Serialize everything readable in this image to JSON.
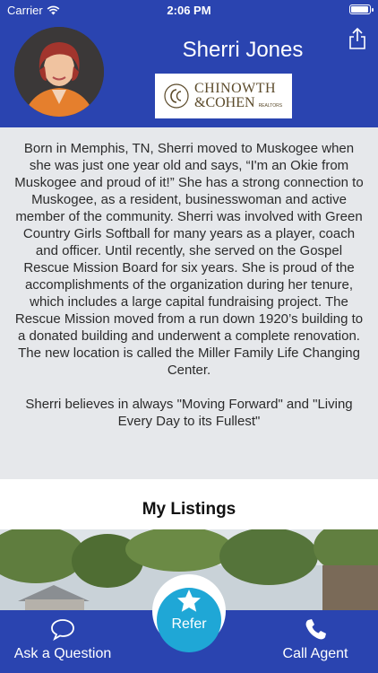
{
  "status_bar": {
    "carrier": "Carrier",
    "time": "2:06 PM"
  },
  "profile": {
    "name": "Sherri Jones",
    "logo": {
      "line1": "CHINOWTH",
      "line2": "&COHEN",
      "tag": "REALTORS"
    }
  },
  "bio": {
    "paragraphs": [
      "Born in Memphis, TN, Sherri moved to Muskogee when she was just one year old and says, “I'm an Okie from Muskogee and proud of it!” She has a strong connection to Muskogee, as a resident, businesswoman and active member of the community. Sherri was involved with Green Country Girls Softball for many years as a player, coach and officer. Until recently, she served on the Gospel Rescue Mission Board for six years.  She is proud of the accomplishments of the organization during her tenure, which includes a large capital fundraising project. The Rescue Mission moved from a run down 1920’s building to a donated building and underwent a complete renovation. The new location is called the Miller Family Life Changing Center.",
      "Sherri believes in always \"Moving Forward\" and \"Living Every Day to its Fullest\""
    ]
  },
  "listings": {
    "title": "My Listings"
  },
  "tab_bar": {
    "ask": "Ask a Question",
    "refer": "Refer",
    "call": "Call Agent"
  },
  "colors": {
    "primary": "#2a44b0",
    "accent": "#1fa7d6",
    "background": "#e6e8eb"
  },
  "icons": [
    "wifi-icon",
    "battery-icon",
    "share-icon",
    "speech-bubble-icon",
    "star-icon",
    "phone-icon"
  ]
}
